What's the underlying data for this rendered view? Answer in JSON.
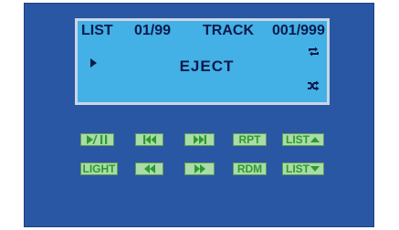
{
  "display": {
    "list_label": "LIST",
    "list_value": "01/99",
    "track_label": "TRACK",
    "track_value": "001/999",
    "status": "EJECT",
    "play_indicator_icon": "play-arrow-icon",
    "repeat_icon": "repeat-icon",
    "shuffle_icon": "shuffle-icon"
  },
  "buttons": {
    "play_pause_icon": "play-pause-icon",
    "previous_track_icon": "previous-track-icon",
    "next_track_icon": "next-track-icon",
    "repeat_label": "RPT",
    "list_up_label": "LIST",
    "list_up_icon": "triangle-up-icon",
    "light_label": "LIGHT",
    "rewind_icon": "rewind-icon",
    "fast_forward_icon": "fast-forward-icon",
    "random_label": "RDM",
    "list_down_label": "LIST",
    "list_down_icon": "triangle-down-icon"
  },
  "colors": {
    "panel_background": "#2957a3",
    "lcd_background": "#43b0e6",
    "lcd_text": "#0d1a4a",
    "button_background": "#a9dca6",
    "button_text": "#2e9a2e"
  }
}
